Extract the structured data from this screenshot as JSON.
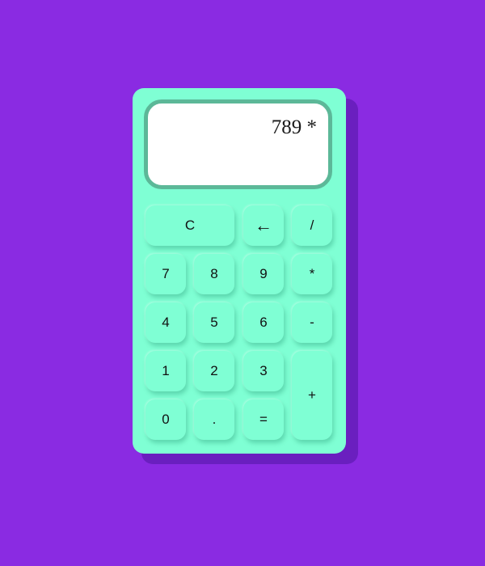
{
  "display": {
    "value": "789 *"
  },
  "keys": {
    "clear": "C",
    "backspace": "←",
    "divide": "/",
    "seven": "7",
    "eight": "8",
    "nine": "9",
    "multiply": "*",
    "four": "4",
    "five": "5",
    "six": "6",
    "minus": "-",
    "one": "1",
    "two": "2",
    "three": "3",
    "plus": "+",
    "zero": "0",
    "decimal": ".",
    "equals": "="
  },
  "colors": {
    "background": "#8a2be2",
    "calculator_body": "#7fffd4",
    "display_border": "#5cb898",
    "display_bg": "#ffffff"
  }
}
